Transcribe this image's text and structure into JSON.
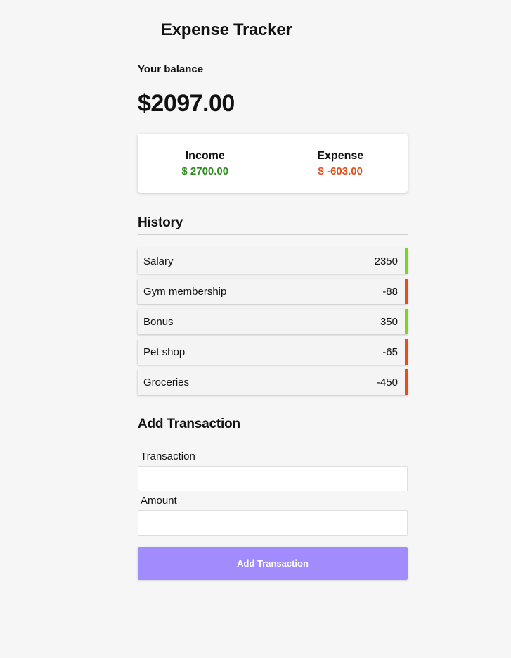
{
  "header": {
    "title": "Expense Tracker"
  },
  "balance": {
    "label": "Your balance",
    "value": "$2097.00"
  },
  "summary": {
    "income_label": "Income",
    "income_amount": "$ 2700.00",
    "expense_label": "Expense",
    "expense_amount": "$ -603.00"
  },
  "history": {
    "heading": "History",
    "items": [
      {
        "name": "Salary",
        "amount": "2350",
        "type": "income"
      },
      {
        "name": "Gym membership",
        "amount": "-88",
        "type": "expense"
      },
      {
        "name": "Bonus",
        "amount": "350",
        "type": "income"
      },
      {
        "name": "Pet shop",
        "amount": "-65",
        "type": "expense"
      },
      {
        "name": "Groceries",
        "amount": "-450",
        "type": "expense"
      }
    ]
  },
  "form": {
    "heading": "Add Transaction",
    "transaction_label": "Transaction",
    "transaction_value": "",
    "amount_label": "Amount",
    "amount_value": "",
    "submit_label": "Add Transaction"
  },
  "colors": {
    "income": "#2e8b1f",
    "expense": "#e0501f",
    "income_border": "#7ed321",
    "button": "#a28bfd"
  }
}
